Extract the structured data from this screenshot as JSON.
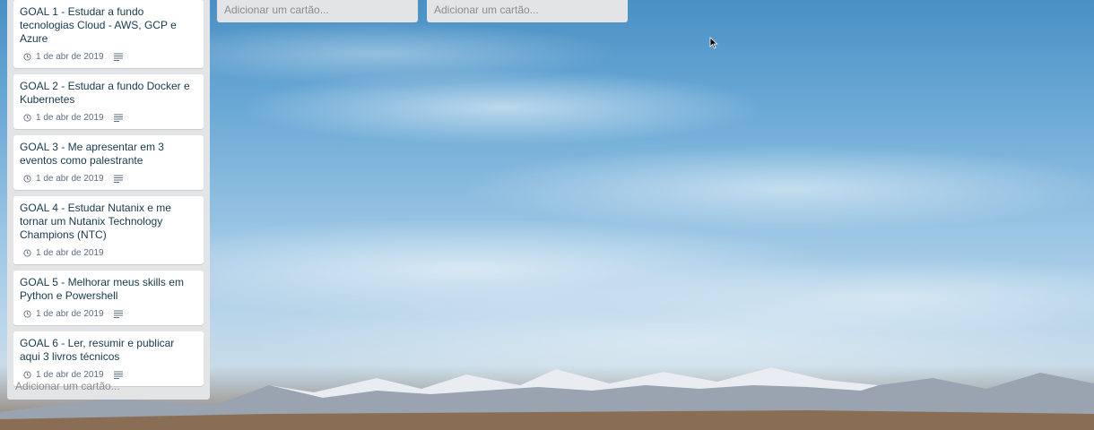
{
  "lists": {
    "main": {
      "cards": [
        {
          "title": "GOAL 1 - Estudar a fundo tecnologias Cloud - AWS, GCP e Azure",
          "date": "1 de abr de 2019",
          "has_description": true
        },
        {
          "title": "GOAL 2 - Estudar a fundo Docker e Kubernetes",
          "date": "1 de abr de 2019",
          "has_description": true
        },
        {
          "title": "GOAL 3 - Me apresentar em 3 eventos como palestrante",
          "date": "1 de abr de 2019",
          "has_description": true
        },
        {
          "title": "GOAL 4 - Estudar Nutanix e me tornar um Nutanix Technology Champions (NTC)",
          "date": "1 de abr de 2019",
          "has_description": false
        },
        {
          "title": "GOAL 5 - Melhorar meus skills em Python e Powershell",
          "date": "1 de abr de 2019",
          "has_description": true
        },
        {
          "title": "GOAL 6 - Ler, resumir e publicar aqui 3 livros técnicos",
          "date": "1 de abr de 2019",
          "has_description": true
        }
      ],
      "add_card_label": "Adicionar um cartão..."
    },
    "second": {
      "add_card_label": "Adicionar um cartão..."
    },
    "third": {
      "add_card_label": "Adicionar um cartão..."
    }
  },
  "icons": {
    "due_date": "clock-icon",
    "description": "description-icon"
  }
}
